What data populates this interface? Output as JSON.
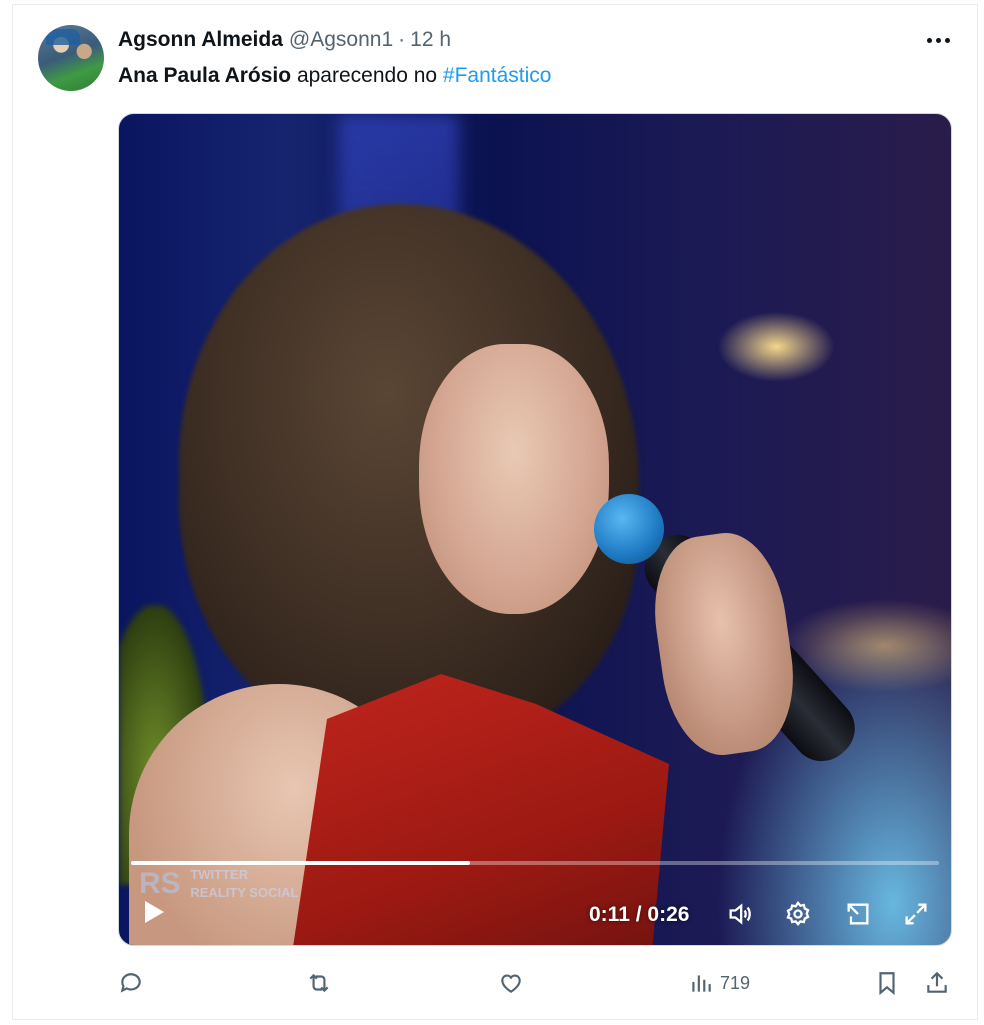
{
  "author": {
    "display_name": "Agsonn Almeida",
    "handle": "@Agsonn1",
    "separator": "·",
    "timestamp": "12 h"
  },
  "tweet": {
    "text_bold": "Ana Paula Arósio",
    "text_plain": " aparecendo no ",
    "hashtag": "#Fantástico"
  },
  "video": {
    "current_time": "0:11",
    "time_separator": " / ",
    "duration": "0:26",
    "progress": 0.42,
    "watermark_logo": "RS",
    "watermark_line1": "TWITTER",
    "watermark_line2": "REALITY SOCIAL"
  },
  "actions": {
    "views_count": "719"
  },
  "icons": {
    "more": "more-horizontal-icon",
    "reply": "reply-icon",
    "retweet": "retweet-icon",
    "like": "heart-icon",
    "views": "analytics-icon",
    "bookmark": "bookmark-icon",
    "share": "share-icon",
    "volume": "volume-icon",
    "settings": "gear-icon",
    "pip": "picture-in-picture-icon",
    "fullscreen": "fullscreen-icon"
  },
  "colors": {
    "hashtag": "#1d9bf0",
    "text": "#0f1419",
    "secondary": "#536471"
  }
}
